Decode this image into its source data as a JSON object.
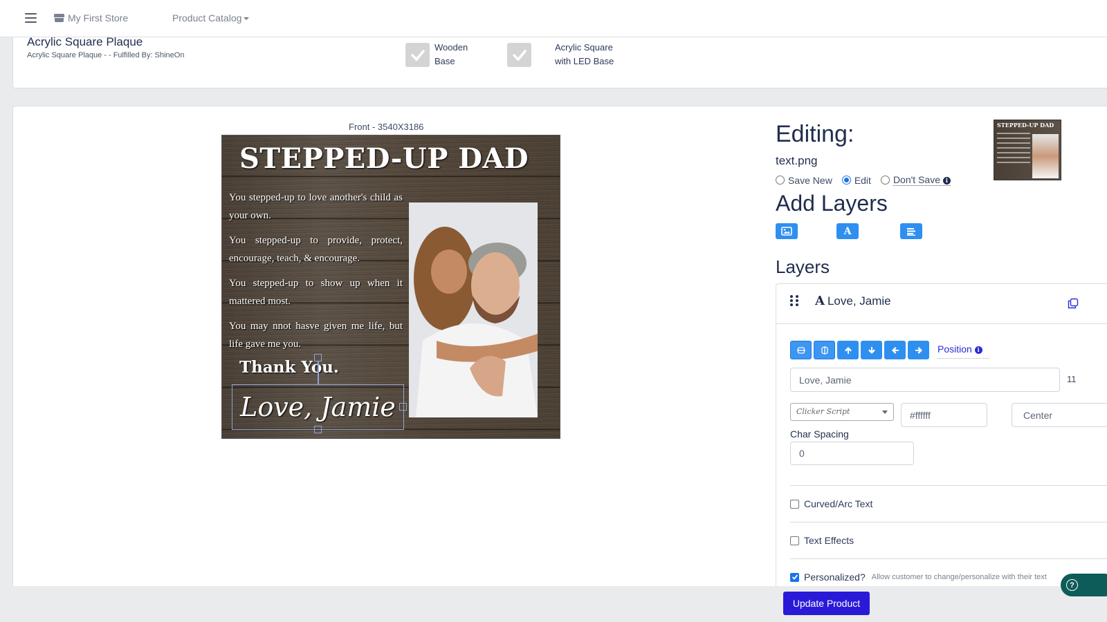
{
  "navbar": {
    "store_name": "My First Store",
    "catalog_label": "Product Catalog"
  },
  "product": {
    "title": "Acrylic Square Plaque",
    "subtitle": "Acrylic Square Plaque - - Fulfilled By: ShineOn",
    "variants": [
      {
        "label_line1": "Wooden",
        "label_line2": "Base",
        "checked": true
      },
      {
        "label_line1": "Acrylic Square",
        "label_line2": "with LED Base",
        "checked": true
      }
    ]
  },
  "canvas": {
    "label": "Front - 3540X3186",
    "design": {
      "title": "STEPPED-UP DAD",
      "paragraphs": [
        "You stepped-up to love another's child as your own.",
        "You stepped-up to provide, protect, encourage, teach, & encourage.",
        "You  stepped-up to show up when it mattered most.",
        "You may nnot hasve given me life, but life gave me you."
      ],
      "thanks": "Thank You.",
      "signature": "Love, Jamie",
      "photo_alt": "Father and daughter photo"
    }
  },
  "editor": {
    "editing_heading": "Editing:",
    "filename": "text.png",
    "save_options": [
      {
        "label": "Save New",
        "selected": false
      },
      {
        "label": "Edit",
        "selected": true
      },
      {
        "label": "Don't Save",
        "selected": false
      }
    ],
    "thumbnail_title": "STEPPED-UP DAD",
    "add_layers_heading": "Add Layers",
    "add_layer_buttons": [
      {
        "name": "add-image-layer",
        "icon": "image-icon"
      },
      {
        "name": "add-text-layer",
        "icon": "font-icon"
      },
      {
        "name": "add-textbox-layer",
        "icon": "align-left-icon"
      }
    ],
    "layers_heading": "Layers",
    "layer": {
      "name": "Love, Jamie",
      "type_icon": "A",
      "position_label": "Position",
      "text_value": "Love, Jamie",
      "font_size": "11",
      "font": "Clicker Script",
      "color": "#ffffff",
      "alignment": "Center",
      "char_spacing_label": "Char Spacing",
      "char_spacing": "0",
      "options": [
        {
          "label": "Curved/Arc Text",
          "checked": false
        },
        {
          "label": "Text Effects",
          "checked": false
        },
        {
          "label": "Personalized?",
          "checked": true,
          "help": "Allow customer to change/personalize with their text"
        }
      ]
    }
  },
  "footer": {
    "update_label": "Update Product"
  },
  "colors": {
    "primary_button": "#2f8ff0",
    "update_button": "#2a1ad8",
    "help_button": "#0d5c5a",
    "link": "#2b2bd6"
  }
}
